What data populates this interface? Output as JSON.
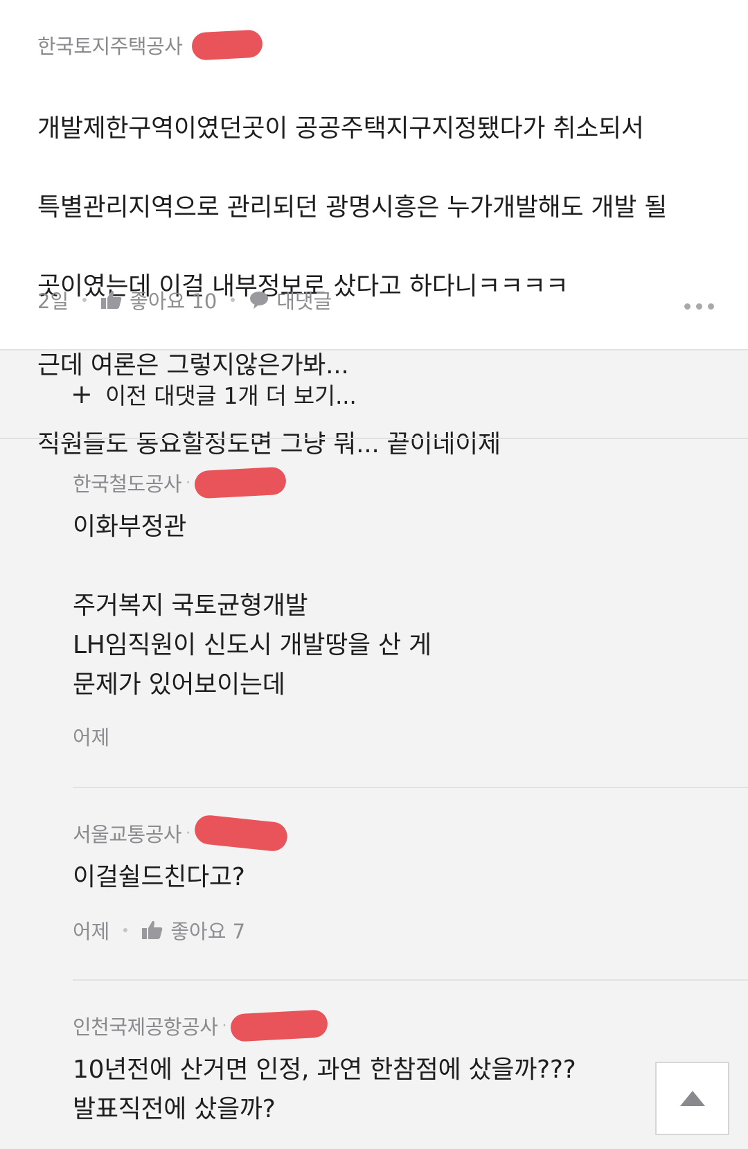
{
  "top_comment": {
    "author": "한국토지주택공사",
    "lines": [
      "개발제한구역이였던곳이 공공주택지구지정됐다가 취소되서",
      "특별관리지역으로 관리되던 광명시흥은 누가개발해도 개발 될",
      "곳이였는데 이걸 내부정보로 샀다고 하다니ㅋㅋㅋㅋ",
      "근데 여론은 그렇지않은가봐...",
      "직원들도 동요할정도면 그냥 뭐... 끝이네이제"
    ],
    "time": "2일",
    "like_label": "좋아요 10",
    "reply_label": "대댓글"
  },
  "load_more": {
    "plus": "+",
    "label": "이전 대댓글 1개 더 보기..."
  },
  "replies": [
    {
      "author": "한국철도공사",
      "text": "이화부정관\n\n주거복지 국토균형개발\nLH임직원이 신도시 개발땅을 산 게\n문제가 있어보이는데",
      "time": "어제"
    },
    {
      "author": "서울교통공사",
      "text": "이걸쉴드친다고?",
      "time": "어제",
      "like_label": "좋아요 7"
    },
    {
      "author": "인천국제공항공사",
      "text": "10년전에 산거면 인정, 과연 한참점에 샀을까???\n발표직전에 샀을까?"
    }
  ],
  "colors": {
    "redaction": "#e8545a",
    "meta_text": "#8e8e92",
    "background": "#f3f3f4"
  },
  "icons": [
    "thumbs-up-icon",
    "speech-bubble-icon",
    "more-options-icon",
    "scroll-to-top-icon"
  ]
}
